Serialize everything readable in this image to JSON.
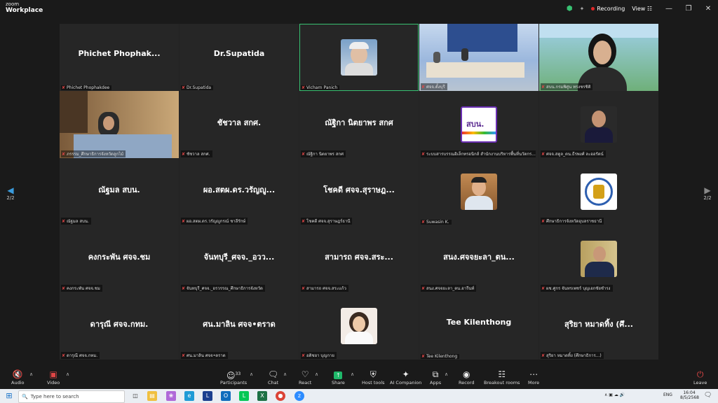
{
  "app": {
    "logo_line1": "zoom",
    "logo_line2": "Workplace"
  },
  "titlebar": {
    "recording": "Recording",
    "view": "View"
  },
  "page_indicator": "2/2",
  "tiles": [
    {
      "big": "Phichet  Phophak...",
      "label": "Phichet Phophakdee"
    },
    {
      "big": "Dr.Supatida",
      "label": "Dr.Supatida"
    },
    {
      "big": "",
      "label": "Vicharn Panich",
      "image": "portrait"
    },
    {
      "big": "",
      "label": "ศจจ.ตั้งบุรี",
      "image": "classroom"
    },
    {
      "big": "",
      "label": "สบน.กรมพิศูน ทรงชรชิติ",
      "image": "woman"
    },
    {
      "big": "",
      "label": "ภรรรม_ศึกษาธิการจังหวัดลูกไม้",
      "image": "office"
    },
    {
      "big": "ชัชวาล สกศ.",
      "label": "ชัชวาล สกศ."
    },
    {
      "big": "ณัฐิกา นิตยาพร สกศ",
      "label": "ณัฐิกา นิตยาพร สกศ"
    },
    {
      "big": "",
      "label": "ระบบสารบรรณอิเล็กทรอนิกส์ สำนักงานบริหารพื้นที่นวัตกร...",
      "image": "logo_sbn"
    },
    {
      "big": "",
      "label": "ศจจ.สตูล_ตน.ธีรพงศ์ ละออรัตน์",
      "image": "man_suit"
    },
    {
      "big": "ณัฐมล สบน.",
      "label": "ณัฐมล สบน."
    },
    {
      "big": "ผอ.สตผ.ดร.วรัญญู...",
      "label": "ผอ.สตผ.ดร.วรัญญูกรณ์ ชาลีรักษ์"
    },
    {
      "big": "โชคดี ศจจ.สุราษฎ...",
      "label": "โชคดี ศจจ.สุราษฎร์ธานี"
    },
    {
      "big": "",
      "label": "Suwasin K.",
      "image": "young_man"
    },
    {
      "big": "",
      "label": "ศึกษาธิการจังหวัดอุบลราชธานี",
      "image": "emblem"
    },
    {
      "big": "คงกระพัน ศจจ.ชม",
      "label": "คงกระพัน ศจจ.ชม"
    },
    {
      "big": "จันทบุรี_ศจจ._อวว...",
      "label": "จันทบุรี_ศจจ._อรวรรณ_ศึกษาธิการจังหวัด"
    },
    {
      "big": "สามารถ ศจจ.สระ...",
      "label": "สามารถ ศจจ.สระแก้ว"
    },
    {
      "big": "สนง.ศจจยะลา_ตน...",
      "label": "สนง.ศจจยะลา_ตน.อารีนท์"
    },
    {
      "big": "",
      "label": "ผช.ศูกร จันทรเพชร์ บุญเอกชัยชำรง",
      "image": "man_flag"
    },
    {
      "big": "ดารุณี ศจจ.กทม.",
      "label": "ดารุณี ศจจ.กทม."
    },
    {
      "big": "ศน.มาลิน ศจจ•ตราด",
      "label": "ศน.มาลิน ศจจ•ตราด"
    },
    {
      "big": "",
      "label": "อติชยา บุญกาย",
      "image": "girl"
    },
    {
      "big": "Tee Kilenthong",
      "label": "Tee Kilenthong"
    },
    {
      "big": "สุริยา หมาดทิ้ง (ศึ...",
      "label": "สุริยา หมาดทิ้ง (ศึกษาธิการ...)"
    }
  ],
  "toolbar": {
    "audio": "Audio",
    "video": "Video",
    "participants": "Participants",
    "participants_count": "33",
    "chat": "Chat",
    "react": "React",
    "share": "Share",
    "host_tools": "Host tools",
    "ai_companion": "AI Companion",
    "apps": "Apps",
    "record": "Record",
    "breakout": "Breakout rooms",
    "more": "More",
    "leave": "Leave"
  },
  "taskbar": {
    "search_placeholder": "Type here to search",
    "lang": "ENG",
    "time": "16:04",
    "date": "8/5/2568"
  },
  "colors": {
    "active_border": "#38c172",
    "share_green": "#1fb86a",
    "muted_red": "#e04646"
  }
}
